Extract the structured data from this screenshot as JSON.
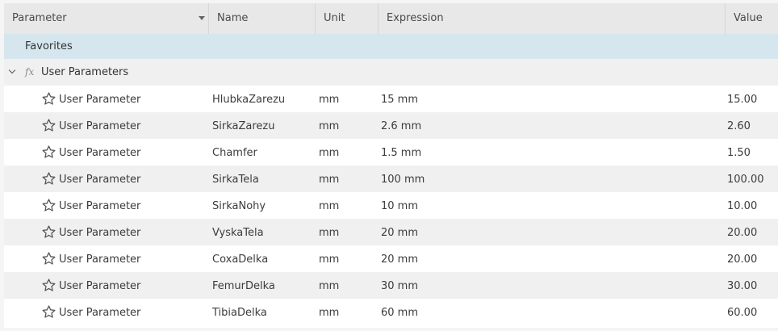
{
  "columns": {
    "parameter": "Parameter",
    "name": "Name",
    "unit": "Unit",
    "expression": "Expression",
    "value": "Value"
  },
  "favorites": {
    "label": "Favorites"
  },
  "group": {
    "icon": "fx-icon",
    "fx": "fx",
    "label": "User Parameters",
    "expanded": true
  },
  "rows": [
    {
      "type": "User Parameter",
      "name": "HlubkaZarezu",
      "unit": "mm",
      "expression": "15 mm",
      "value": "15.00"
    },
    {
      "type": "User Parameter",
      "name": "SirkaZarezu",
      "unit": "mm",
      "expression": "2.6 mm",
      "value": "2.60"
    },
    {
      "type": "User Parameter",
      "name": "Chamfer",
      "unit": "mm",
      "expression": "1.5 mm",
      "value": "1.50"
    },
    {
      "type": "User Parameter",
      "name": "SirkaTela",
      "unit": "mm",
      "expression": "100 mm",
      "value": "100.00"
    },
    {
      "type": "User Parameter",
      "name": "SirkaNohy",
      "unit": "mm",
      "expression": "10 mm",
      "value": "10.00"
    },
    {
      "type": "User Parameter",
      "name": "VyskaTela",
      "unit": "mm",
      "expression": "20 mm",
      "value": "20.00"
    },
    {
      "type": "User Parameter",
      "name": "CoxaDelka",
      "unit": "mm",
      "expression": "20 mm",
      "value": "20.00"
    },
    {
      "type": "User Parameter",
      "name": "FemurDelka",
      "unit": "mm",
      "expression": "30 mm",
      "value": "30.00"
    },
    {
      "type": "User Parameter",
      "name": "TibiaDelka",
      "unit": "mm",
      "expression": "60 mm",
      "value": "60.00"
    }
  ]
}
